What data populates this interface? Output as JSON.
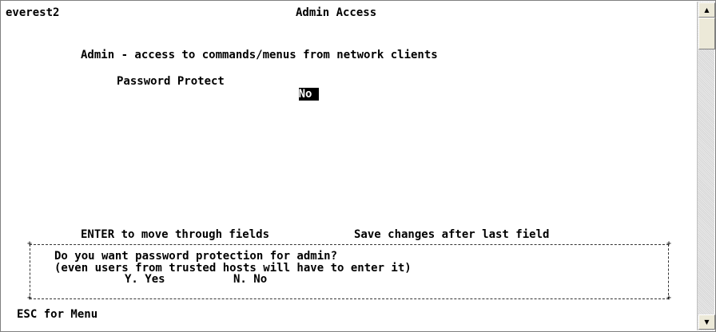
{
  "header": {
    "hostname": "everest2",
    "screen_title": "Admin Access"
  },
  "section": {
    "heading": "Admin - access to commands/menus from network clients",
    "field_label": "Password Protect",
    "field_value": "No"
  },
  "hint": {
    "enter_text": "ENTER to move through fields",
    "save_text": "Save changes after last field"
  },
  "prompt": {
    "question": "Do you want password protection for admin?",
    "note": "(even users from trusted hosts will have to enter it)",
    "option_yes": "Y. Yes",
    "option_no": "N. No"
  },
  "footer": {
    "esc_text": "ESC for Menu"
  },
  "scrollbar": {
    "up_icon": "▲",
    "down_icon": "▼"
  }
}
